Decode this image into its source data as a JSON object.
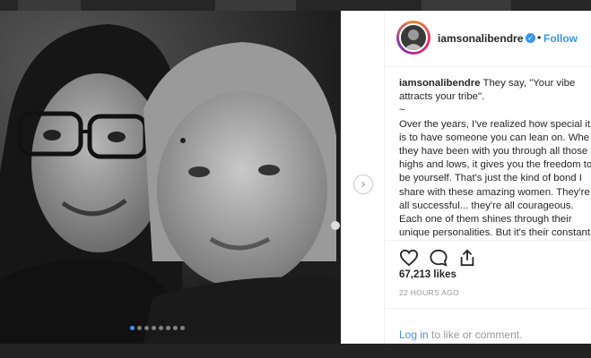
{
  "post": {
    "username": "iamsonalibendre",
    "follow_separator": "•",
    "follow_label": "Follow",
    "caption_lines": [
      "They say, \"Your vibe",
      "attracts your tribe\".",
      "~",
      "Over the years, I've realized how special it",
      "is to have someone you can lean on. Whe",
      "they have been with you through all those",
      "highs and lows, it gives you the freedom to",
      "be yourself. That's just the kind of bond I",
      "share with these amazing women. They're",
      "all successful... they're all courageous.",
      "Each one of them shines through their",
      "unique personalities. But it's their constant"
    ],
    "likes": "67,213 likes",
    "timestamp": "22 HOURS AGO",
    "login_link": "Log in",
    "login_rest": " to like or comment."
  },
  "carousel": {
    "slide_count": 8,
    "active_index": 0,
    "next_arrow": "›"
  },
  "icons": [
    "heart-icon",
    "comment-icon",
    "share-icon",
    "verified-badge-icon",
    "next-arrow-icon"
  ],
  "colors": {
    "accent": "#3897f0",
    "text": "#262626",
    "muted": "#999999",
    "border": "#efefef"
  }
}
